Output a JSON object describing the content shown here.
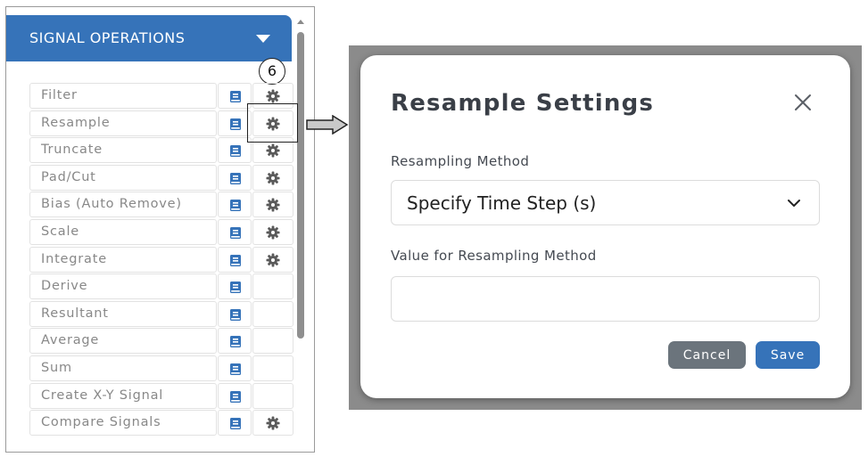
{
  "sidebar": {
    "header_title": "SIGNAL OPERATIONS",
    "badge": "6",
    "operations": [
      {
        "label": "Filter",
        "has_settings": true
      },
      {
        "label": "Resample",
        "has_settings": true
      },
      {
        "label": "Truncate",
        "has_settings": true
      },
      {
        "label": "Pad/Cut",
        "has_settings": true
      },
      {
        "label": "Bias (Auto Remove)",
        "has_settings": true
      },
      {
        "label": "Scale",
        "has_settings": true
      },
      {
        "label": "Integrate",
        "has_settings": true
      },
      {
        "label": "Derive",
        "has_settings": false
      },
      {
        "label": "Resultant",
        "has_settings": false
      },
      {
        "label": "Average",
        "has_settings": false
      },
      {
        "label": "Sum",
        "has_settings": false
      },
      {
        "label": "Create X-Y Signal",
        "has_settings": false
      },
      {
        "label": "Compare Signals",
        "has_settings": true
      }
    ]
  },
  "modal": {
    "title": "Resample Settings",
    "method_label": "Resampling Method",
    "method_value": "Specify Time Step (s)",
    "value_label": "Value for Resampling Method",
    "value_input": "",
    "cancel_label": "Cancel",
    "save_label": "Save"
  },
  "colors": {
    "accent": "#3673b9",
    "doc_icon": "#3673b9",
    "gear_icon": "#5a5a5a",
    "cancel_button": "#6b747c",
    "backdrop": "#8b8b8b"
  },
  "icons": {
    "header_toggle": "caret-down-icon",
    "doc": "book-icon",
    "settings": "gear-icon",
    "close": "close-icon",
    "dropdown": "chevron-down-icon",
    "pointer": "arrow-right-icon"
  }
}
